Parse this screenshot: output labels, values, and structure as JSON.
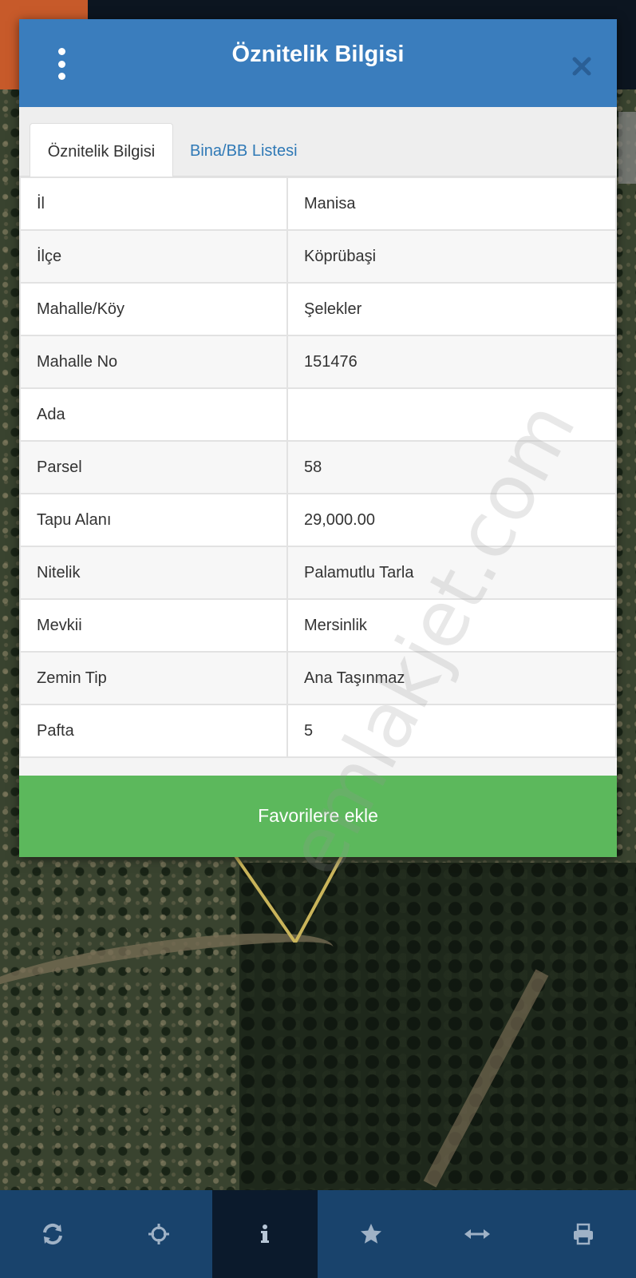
{
  "dialog": {
    "title": "Öznitelik Bilgisi",
    "tabs": [
      {
        "label": "Öznitelik Bilgisi",
        "active": true
      },
      {
        "label": "Bina/BB Listesi",
        "active": false
      }
    ],
    "rows": [
      {
        "key": "İl",
        "value": "Manisa"
      },
      {
        "key": "İlçe",
        "value": "Köprübaşi"
      },
      {
        "key": "Mahalle/Köy",
        "value": "Şelekler"
      },
      {
        "key": "Mahalle No",
        "value": "151476"
      },
      {
        "key": "Ada",
        "value": ""
      },
      {
        "key": "Parsel",
        "value": "58"
      },
      {
        "key": "Tapu Alanı",
        "value": "29,000.00"
      },
      {
        "key": "Nitelik",
        "value": "Palamutlu Tarla"
      },
      {
        "key": "Mevkii",
        "value": "Mersinlik"
      },
      {
        "key": "Zemin Tip",
        "value": "Ana Taşınmaz"
      },
      {
        "key": "Pafta",
        "value": "5"
      }
    ],
    "favorite_button": "Favorilere ekle"
  },
  "watermark": "emlakjet.com",
  "toolbar": {
    "buttons": [
      {
        "icon": "refresh-icon",
        "active": false
      },
      {
        "icon": "crosshair-icon",
        "active": false
      },
      {
        "icon": "info-icon",
        "active": true
      },
      {
        "icon": "star-icon",
        "active": false
      },
      {
        "icon": "measure-arrows-icon",
        "active": false
      },
      {
        "icon": "print-icon",
        "active": false
      }
    ]
  },
  "colors": {
    "header_blue": "#3a7dbd",
    "tab_link_blue": "#2f79b6",
    "favorite_green": "#5cb85c",
    "toolbar_blue": "#19436c",
    "toolbar_active": "#0b1a2c"
  }
}
